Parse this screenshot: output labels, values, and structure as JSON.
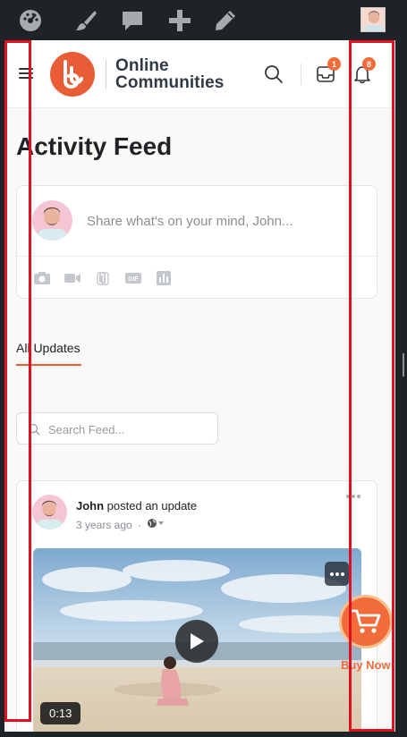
{
  "adminbar": {
    "icons": [
      "dashboard-icon",
      "brush-icon",
      "comment-icon",
      "plus-icon",
      "pencil-icon"
    ]
  },
  "header": {
    "brand_line1": "Online",
    "brand_line2": "Communities",
    "inbox_count": "1",
    "notifications_count": "8"
  },
  "page": {
    "title": "Activity Feed"
  },
  "composer": {
    "placeholder": "Share what's on your mind, John...",
    "tools": [
      "camera-icon",
      "video-icon",
      "attachment-icon",
      "gif-icon",
      "poll-icon"
    ],
    "gif_label": "GIF"
  },
  "tabs": {
    "active": "All Updates"
  },
  "search": {
    "placeholder": "Search Feed..."
  },
  "post": {
    "author": "John",
    "action": " posted an update",
    "time": "3 years ago",
    "separator": "·",
    "video_duration": "0:13"
  },
  "buy_now": {
    "label": "Buy Now"
  },
  "colors": {
    "accent": "#e85d36",
    "badge": "#f26b3a",
    "highlight": "#e01020"
  }
}
